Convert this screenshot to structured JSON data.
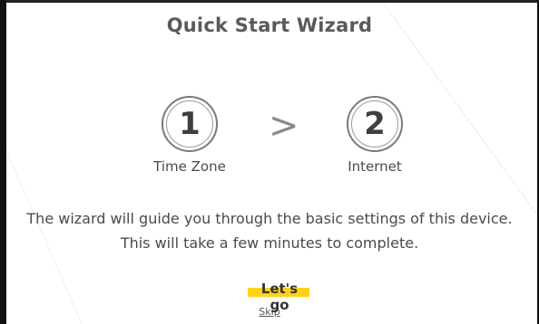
{
  "wizard": {
    "title": "Quick Start Wizard",
    "steps": [
      {
        "number": "1",
        "label": "Time Zone"
      },
      {
        "number": "2",
        "label": "Internet"
      }
    ],
    "separator": ">",
    "description_line1": "The wizard will guide you through the basic settings of this device.",
    "description_line2": "This will take a few minutes to complete.",
    "primary_action": "Let's go",
    "secondary_action": "Skip"
  },
  "colors": {
    "highlight": "#ffd21a",
    "text": "#4a4a4a"
  }
}
